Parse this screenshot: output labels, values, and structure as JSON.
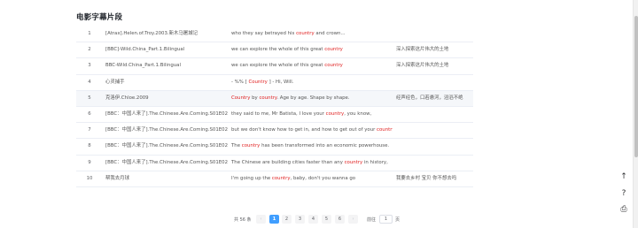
{
  "page": {
    "title": "电影字幕片段"
  },
  "rows": [
    {
      "no": "1",
      "title": "[Atrax].Helen.of.Troy.2003.新木马屠城记",
      "en": [
        {
          "t": "who they say betrayed his "
        },
        {
          "t": "country",
          "k": true
        },
        {
          "t": " and crown..."
        }
      ],
      "zh": ""
    },
    {
      "no": "2",
      "title": "[BBC]-Wild.China_Part.1.Bilingual",
      "en": [
        {
          "t": "we can explore the whole of this great "
        },
        {
          "t": "country",
          "k": true
        }
      ],
      "zh": "深入探索这片伟大的土地"
    },
    {
      "no": "3",
      "title": "BBC-Wild.China_Part.1.Bilingual",
      "en": [
        {
          "t": "we can explore the whole of this great "
        },
        {
          "t": "country",
          "k": true
        }
      ],
      "zh": "深入探索这片伟大的土地"
    },
    {
      "no": "4",
      "title": "心灵捕手",
      "en": [
        {
          "t": "- %% [ "
        },
        {
          "t": "Country",
          "k": true
        },
        {
          "t": " ] - Hi, Will."
        }
      ],
      "zh": ""
    },
    {
      "no": "5",
      "title": "克洛伊.Chloe.2009",
      "en": [
        {
          "t": "Country",
          "k": true
        },
        {
          "t": " by "
        },
        {
          "t": "country",
          "k": true
        },
        {
          "t": ". Age by age. Shape by shape."
        }
      ],
      "zh": "经声经色，口若悬河，滔滔不绝"
    },
    {
      "no": "6",
      "title": "[BBC：中国人来了].The.Chinese.Are.Coming.S01E02",
      "en": [
        {
          "t": "they said to me, Mr Batista, I love your "
        },
        {
          "t": "country",
          "k": true
        },
        {
          "t": ", you know,"
        }
      ],
      "zh": ""
    },
    {
      "no": "7",
      "title": "[BBC：中国人来了].The.Chinese.Are.Coming.S01E02",
      "en": [
        {
          "t": "but we don't know how to get in, and how to get out of your "
        },
        {
          "t": "country",
          "k": true
        },
        {
          "t": "."
        }
      ],
      "zh": ""
    },
    {
      "no": "8",
      "title": "[BBC：中国人来了].The.Chinese.Are.Coming.S01E02",
      "en": [
        {
          "t": "The "
        },
        {
          "t": "country",
          "k": true
        },
        {
          "t": " has been transformed into an economic powerhouse."
        }
      ],
      "zh": ""
    },
    {
      "no": "9",
      "title": "[BBC：中国人来了].The.Chinese.Are.Coming.S01E02",
      "en": [
        {
          "t": "The Chinese are building cities faster than any "
        },
        {
          "t": "country",
          "k": true
        },
        {
          "t": " in history,"
        }
      ],
      "zh": ""
    },
    {
      "no": "10",
      "title": "帮我去月球",
      "en": [
        {
          "t": "I'm going up the "
        },
        {
          "t": "country",
          "k": true
        },
        {
          "t": ", baby, don't you wanna go"
        }
      ],
      "zh": "我要去乡村 宝贝 你不想去吗"
    }
  ],
  "pagination": {
    "total": "共 56 条",
    "prev": "‹",
    "pages": [
      "1",
      "2",
      "3",
      "4",
      "5",
      "6"
    ],
    "active": "1",
    "next": "›",
    "goto_label": "前往",
    "goto_value": "1",
    "goto_unit": "页"
  },
  "float_buttons": {
    "top": "↑",
    "help": "?",
    "print": "⎙"
  }
}
